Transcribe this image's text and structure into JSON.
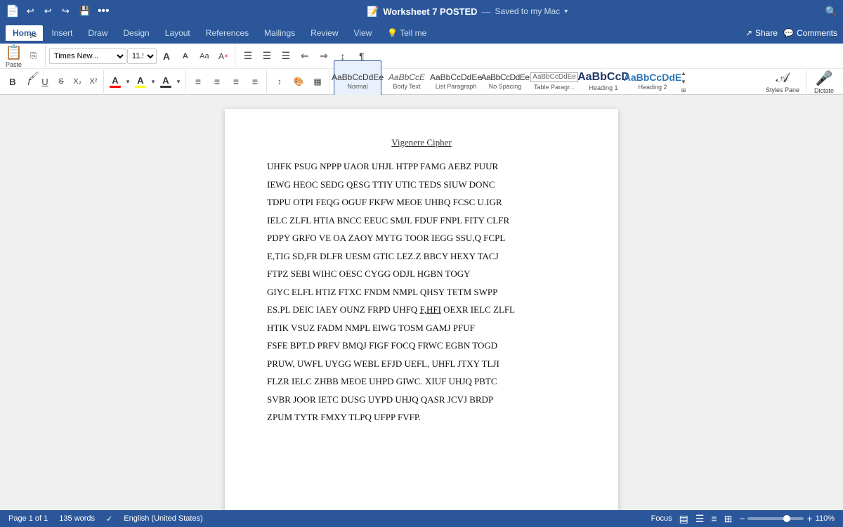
{
  "titlebar": {
    "app_icon": "📄",
    "title": "Worksheet 7 POSTED",
    "separator": "—",
    "saved_text": "Saved to my Mac",
    "saved_icon": "✓",
    "dots_menu": "•••",
    "undo_icon": "↩",
    "undo2_icon": "↩",
    "redo_icon": "↪",
    "save_icon": "💾",
    "search_icon": "🔍",
    "cloud_icon": "☁"
  },
  "ribbon": {
    "tabs": [
      "Home",
      "Insert",
      "Draw",
      "Design",
      "Layout",
      "References",
      "Mailings",
      "Review",
      "View",
      "Tell me"
    ],
    "active_tab": "Home",
    "tell_me_placeholder": "Tell me",
    "share_label": "Share",
    "comments_label": "Comments"
  },
  "toolbar": {
    "clipboard": {
      "paste_label": "Paste"
    },
    "font": {
      "name": "Times New...",
      "size": "11.5",
      "grow_icon": "A",
      "shrink_icon": "A",
      "case_icon": "Aa",
      "clear_icon": "A"
    },
    "paragraph": {
      "bullets_icon": "≡",
      "numbering_icon": "≡",
      "multilevel_icon": "≡",
      "decrease_indent": "←",
      "increase_indent": "→",
      "sort_icon": "↕",
      "show_para": "¶"
    },
    "formatting": {
      "bold": "B",
      "italic": "I",
      "underline": "U",
      "strikethrough": "S",
      "subscript": "X₂",
      "superscript": "X²",
      "font_color_label": "A",
      "font_color": "#000000",
      "highlight_color": "#ffff00",
      "highlight_label": "A"
    },
    "styles": {
      "items": [
        {
          "label": "Normal",
          "preview_class": "normal-preview",
          "preview_text": "AaBbCcDdEe",
          "active": true
        },
        {
          "label": "Body Text",
          "preview_class": "body-text-preview",
          "preview_text": "AaBbCcE"
        },
        {
          "label": "List Paragraph",
          "preview_class": "list-preview",
          "preview_text": "AaBbCcDdEe"
        },
        {
          "label": "No Spacing",
          "preview_class": "no-spacing-preview",
          "preview_text": "AaBbCcDdEe"
        },
        {
          "label": "Table Paragr...",
          "preview_class": "table-preview",
          "preview_text": "AaBbCcDdEe"
        },
        {
          "label": "Heading 1",
          "preview_class": "h1-preview",
          "preview_text": "AaBbCcD"
        },
        {
          "label": "Heading 2",
          "preview_class": "h2-preview",
          "preview_text": "AaBbCcDdE"
        }
      ]
    },
    "styles_pane_label": "Styles Pane",
    "dictate_label": "Dictate"
  },
  "document": {
    "title": "Vigenere Cipher",
    "lines": [
      "UHFK PSUG NPPP UAOR UHJL HTPP FAMG AEBZ PUUR",
      "IEWG HEOC SEDG QESG TTIY UTIC TEDS SIUW DONC",
      "TDPU OTPI FEQG OGUF FKFW MEOE UHBQ FCSC U.IGR",
      "IELC ZLFL HTIA BNCC EEUC SMJL FDUF FNPL FITY CLFR",
      "PDPY GRFO VE OA ZAOY MYTG TOOR IEGG SSU,Q FCPL",
      "E,TIG SD,FR DLFR UESM GTIC LEZ.Z BBCY HEXY TACJ",
      "FTPZ SEBI WIHC OESC CYGG ODJL HGBN TOGY",
      "GIYC ELFL HTIZ FTXC FNDM NMPL QHSY TETM SWPP",
      "ES.PL DEIC IAEY OUNZ FRPD UHFQ F,HFI OEXR IELC ZLFL",
      "HTIK VSUZ FADM NMPL EIWG TOSM GAMJ PFUF",
      "FSFE BPT.D PRFV BMQJ FIGF FOCQ FRWC EGBN TOGD",
      "PRUW, UWFL UYGG WEBL EFJD UEFL, UHFL JTXY TLJI",
      "FLZR IELC ZHBB MEOE UHPD GIWC. XIUF UHJQ PBTC",
      "SVBR JOOR IETC DUSG UYPD UHJQ QASR JCVJ BRDP",
      "ZPUM TYTR FMXY TLPQ UFPP FVFP."
    ],
    "special_line_index": 8,
    "special_word": "F,HFI",
    "special_word_underline": true
  },
  "statusbar": {
    "page_info": "Page 1 of 1",
    "words": "135 words",
    "proofing_icon": "✓",
    "language": "English (United States)",
    "focus_label": "Focus",
    "view_icons": [
      "▤",
      "☰"
    ],
    "zoom_out": "−",
    "zoom_in": "+",
    "zoom_level": "110%"
  }
}
